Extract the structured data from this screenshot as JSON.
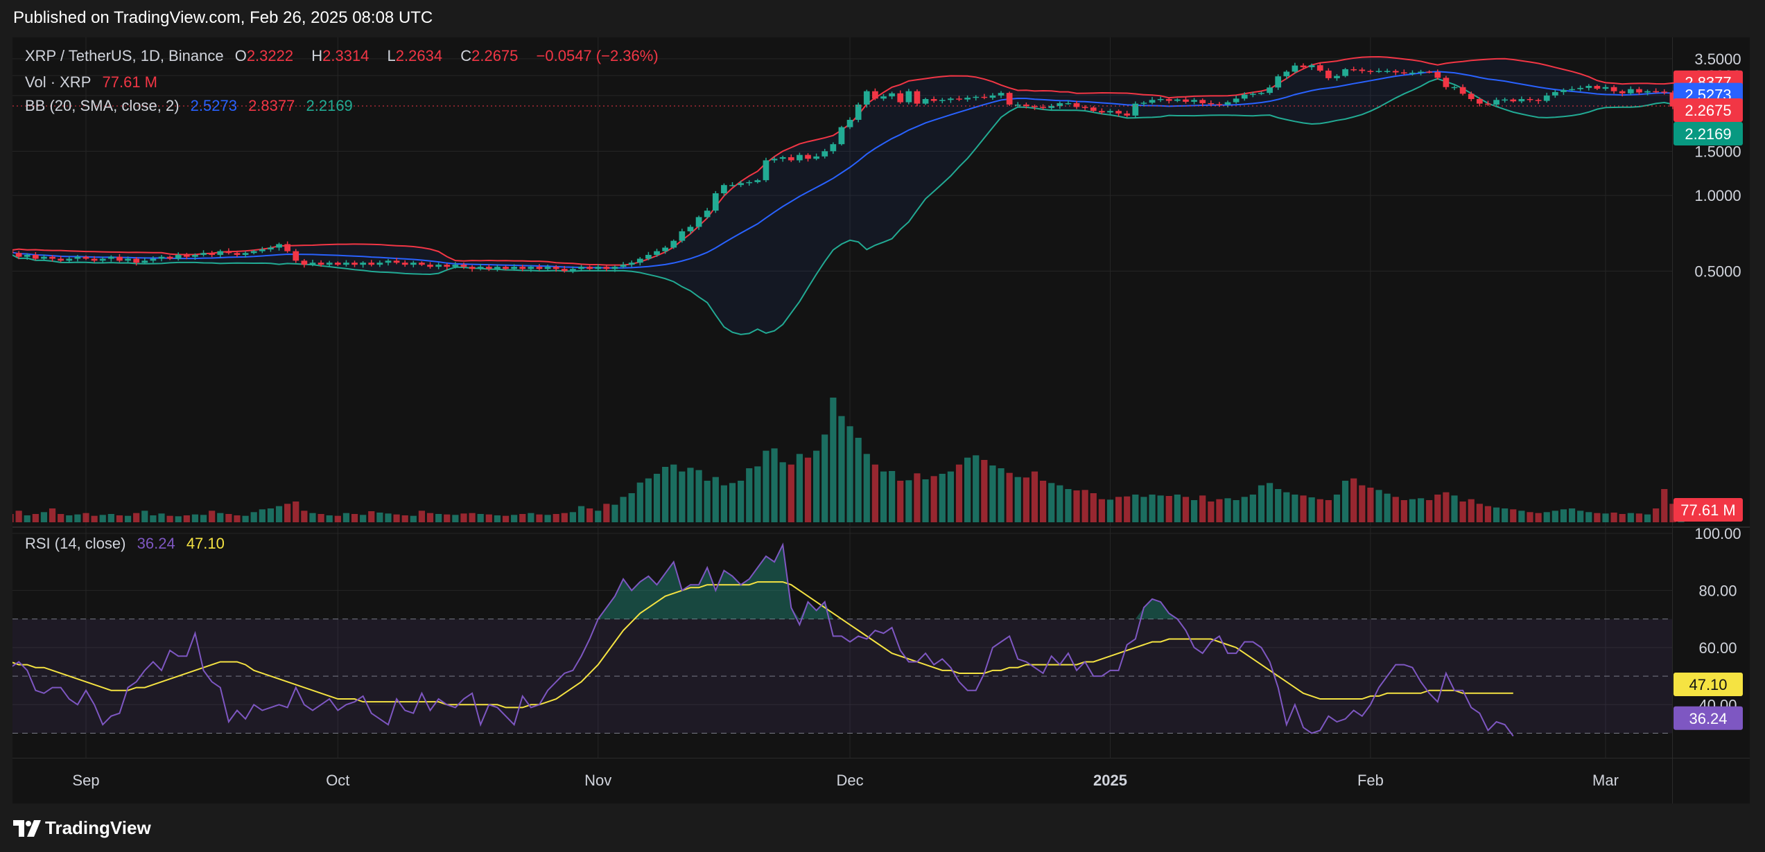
{
  "header": {
    "published": "Published on TradingView.com, Feb 26, 2025 08:08 UTC"
  },
  "footer": {
    "brand": "TradingView"
  },
  "legend": {
    "symbol": "XRP / TetherUS, 1D, Binance",
    "o_label": "O",
    "o": "2.3222",
    "h_label": "H",
    "h": "2.3314",
    "l_label": "L",
    "l": "2.2634",
    "c_label": "C",
    "c": "2.2675",
    "change": "−0.0547 (−2.36%)",
    "vol_label": "Vol · XRP",
    "vol": "77.61 M",
    "bb_label": "BB (20, SMA, close, 2)",
    "bb_basis": "2.5273",
    "bb_upper": "2.8377",
    "bb_lower": "2.2169",
    "rsi_label": "RSI (14, close)",
    "rsi": "36.24",
    "rsi_ma": "47.10"
  },
  "badges": {
    "upper": "2.8377",
    "basis": "2.5273",
    "close": "2.2675",
    "lower": "2.2169",
    "vol": "77.61 M",
    "rsi_ma": "47.10",
    "rsi": "36.24"
  },
  "colors": {
    "up": "#22ab94",
    "down": "#f23645",
    "basis": "#2962ff",
    "upper": "#f23645",
    "lower": "#22ab94",
    "rsi": "#7e57c2",
    "rsi_ma": "#f5e342",
    "bg": "#131313",
    "grid": "#262626"
  },
  "chart_data": {
    "type": "candlestick",
    "price_axis": {
      "ticks": [
        3.5,
        3.0,
        2.5,
        1.5,
        1.0,
        0.5
      ],
      "labels": [
        "3.5000",
        "3.0000",
        "2.5000",
        "1.5000",
        "1.0000",
        "0.5000"
      ],
      "ylim": [
        0.05,
        3.75
      ]
    },
    "rsi_axis": {
      "ticks": [
        100,
        80,
        60,
        40
      ],
      "labels": [
        "100.00",
        "80.00",
        "60.00",
        "40.00"
      ],
      "ylim": [
        26,
        100
      ],
      "bands": [
        70,
        50,
        30
      ]
    },
    "x_labels": [
      {
        "label": "Sep",
        "day": 0
      },
      {
        "label": "Oct",
        "day": 30
      },
      {
        "label": "Nov",
        "day": 61
      },
      {
        "label": "Dec",
        "day": 91
      },
      {
        "label": "2025",
        "day": 122,
        "bold": true
      },
      {
        "label": "Feb",
        "day": 153
      },
      {
        "label": "Mar",
        "day": 181
      }
    ],
    "first_day": -10,
    "series_values": {
      "close": [
        0.6,
        0.59,
        0.57,
        0.58,
        0.56,
        0.57,
        0.56,
        0.55,
        0.56,
        0.57,
        0.56,
        0.55,
        0.56,
        0.57,
        0.55,
        0.56,
        0.54,
        0.55,
        0.56,
        0.57,
        0.56,
        0.58,
        0.57,
        0.58,
        0.59,
        0.58,
        0.6,
        0.59,
        0.58,
        0.59,
        0.6,
        0.61,
        0.62,
        0.64,
        0.6,
        0.55,
        0.53,
        0.54,
        0.53,
        0.54,
        0.53,
        0.54,
        0.53,
        0.54,
        0.53,
        0.54,
        0.55,
        0.54,
        0.53,
        0.54,
        0.53,
        0.52,
        0.53,
        0.52,
        0.53,
        0.52,
        0.51,
        0.52,
        0.51,
        0.52,
        0.51,
        0.52,
        0.51,
        0.52,
        0.51,
        0.52,
        0.51,
        0.5,
        0.51,
        0.52,
        0.51,
        0.52,
        0.51,
        0.52,
        0.53,
        0.54,
        0.56,
        0.58,
        0.6,
        0.62,
        0.66,
        0.72,
        0.75,
        0.82,
        0.87,
        1.02,
        1.1,
        1.1,
        1.12,
        1.13,
        1.15,
        1.38,
        1.4,
        1.42,
        1.38,
        1.45,
        1.4,
        1.43,
        1.5,
        1.6,
        1.87,
        2.0,
        2.3,
        2.6,
        2.43,
        2.48,
        2.55,
        2.35,
        2.6,
        2.32,
        2.42,
        2.38,
        2.4,
        2.43,
        2.41,
        2.45,
        2.47,
        2.45,
        2.5,
        2.56,
        2.3,
        2.3,
        2.27,
        2.25,
        2.23,
        2.27,
        2.33,
        2.33,
        2.25,
        2.24,
        2.17,
        2.14,
        2.17,
        2.12,
        2.08,
        2.32,
        2.34,
        2.4,
        2.42,
        2.38,
        2.41,
        2.36,
        2.4,
        2.33,
        2.31,
        2.3,
        2.35,
        2.43,
        2.52,
        2.54,
        2.56,
        2.69,
        2.98,
        3.11,
        3.29,
        3.24,
        3.3,
        3.14,
        2.93,
        2.99,
        3.18,
        3.17,
        3.13,
        3.12,
        3.13,
        3.13,
        3.09,
        3.06,
        3.08,
        3.11,
        3.1,
        2.94,
        2.7,
        2.7,
        2.54,
        2.42,
        2.32,
        2.3,
        2.4,
        2.41,
        2.37,
        2.42,
        2.4,
        2.38,
        2.5,
        2.58,
        2.63,
        2.65,
        2.68,
        2.73,
        2.66,
        2.7,
        2.6,
        2.55,
        2.65,
        2.57,
        2.6,
        2.59,
        2.57,
        2.26,
        2.32,
        2.27
      ],
      "volume_m": [
        20,
        18,
        25,
        15,
        18,
        22,
        30,
        18,
        15,
        17,
        20,
        14,
        16,
        18,
        15,
        14,
        20,
        25,
        15,
        19,
        14,
        13,
        15,
        17,
        16,
        25,
        20,
        18,
        15,
        14,
        22,
        28,
        30,
        35,
        40,
        45,
        25,
        20,
        18,
        15,
        14,
        20,
        18,
        16,
        24,
        21,
        19,
        17,
        15,
        14,
        25,
        20,
        18,
        17,
        16,
        19,
        20,
        18,
        17,
        15,
        14,
        16,
        18,
        20,
        17,
        16,
        18,
        20,
        22,
        35,
        30,
        25,
        40,
        38,
        55,
        63,
        86,
        95,
        105,
        120,
        125,
        110,
        118,
        113,
        90,
        98,
        80,
        85,
        90,
        117,
        121,
        155,
        160,
        130,
        125,
        148,
        140,
        155,
        190,
        270,
        230,
        208,
        183,
        148,
        125,
        110,
        111,
        90,
        91,
        106,
        93,
        100,
        105,
        110,
        125,
        140,
        145,
        135,
        123,
        117,
        107,
        98,
        97,
        110,
        90,
        85,
        80,
        72,
        69,
        70,
        63,
        50,
        49,
        55,
        56,
        60,
        55,
        60,
        58,
        57,
        60,
        55,
        48,
        58,
        45,
        50,
        52,
        48,
        55,
        60,
        80,
        85,
        72,
        65,
        60,
        58,
        54,
        50,
        48,
        60,
        90,
        95,
        80,
        75,
        70,
        62,
        55,
        48,
        50,
        52,
        48,
        60,
        65,
        58,
        45,
        50,
        40,
        35,
        32,
        30,
        28,
        25,
        22,
        20,
        22,
        25,
        28,
        30,
        25,
        22,
        20,
        19,
        21,
        18,
        20,
        19,
        17,
        30,
        72,
        40,
        8
      ],
      "rsi": [
        53,
        53,
        55,
        52,
        45,
        44,
        46,
        46,
        42,
        40,
        45,
        40,
        33,
        36,
        37,
        46,
        48,
        52,
        55,
        52,
        59,
        57,
        57,
        65,
        52,
        48,
        46,
        34,
        38,
        35,
        40,
        38,
        39,
        40,
        39,
        46,
        40,
        38,
        40,
        42,
        38,
        40,
        41,
        43,
        37,
        35,
        33,
        42,
        38,
        37,
        44,
        38,
        42,
        40,
        39,
        42,
        44,
        33,
        40,
        39,
        36,
        33,
        43,
        39,
        40,
        45,
        48,
        51,
        52,
        57,
        63,
        70,
        74,
        78,
        84,
        80,
        83,
        85,
        82,
        86,
        90,
        80,
        82,
        82,
        88,
        80,
        87,
        85,
        82,
        84,
        88,
        92,
        90,
        96,
        74,
        68,
        76,
        73,
        76,
        64,
        64,
        62,
        64,
        63,
        66,
        65,
        67,
        59,
        55,
        55,
        58,
        54,
        56,
        53,
        48,
        45,
        45,
        51,
        60,
        62,
        64,
        56,
        55,
        53,
        51,
        57,
        54,
        58,
        52,
        55,
        50,
        50,
        52,
        52,
        61,
        63,
        74,
        77,
        76,
        72,
        70,
        66,
        60,
        58,
        62,
        64,
        58,
        58,
        62,
        62,
        60,
        55,
        46,
        33,
        40,
        32,
        30,
        31,
        36,
        34,
        35,
        38,
        36,
        40,
        46,
        50,
        54,
        54,
        53,
        48,
        44,
        41,
        51,
        45,
        45,
        39,
        37,
        31,
        34,
        33,
        29
      ],
      "rsi_ma": [
        55,
        55,
        54,
        54,
        53,
        53,
        52,
        51,
        50,
        49,
        48,
        47,
        46,
        45,
        45,
        45,
        46,
        46,
        47,
        48,
        49,
        50,
        51,
        52,
        53,
        54,
        55,
        55,
        55,
        54,
        52,
        51,
        50,
        49,
        48,
        47,
        46,
        45,
        44,
        43,
        42,
        42,
        42,
        41,
        41,
        41,
        41,
        41,
        41,
        41,
        41,
        41,
        41,
        40,
        40,
        40,
        40,
        40,
        40,
        40,
        39,
        39,
        39,
        40,
        40,
        41,
        42,
        44,
        46,
        48,
        51,
        54,
        58,
        62,
        66,
        69,
        72,
        74,
        76,
        78,
        79,
        80,
        81,
        81,
        82,
        82,
        82,
        82,
        82,
        82,
        83,
        83,
        83,
        83,
        82,
        80,
        78,
        76,
        74,
        72,
        70,
        68,
        66,
        64,
        62,
        60,
        58,
        57,
        56,
        55,
        54,
        53,
        52,
        52,
        51,
        51,
        51,
        51,
        52,
        52,
        53,
        53,
        54,
        54,
        54,
        54,
        54,
        54,
        54,
        55,
        55,
        56,
        57,
        58,
        59,
        60,
        61,
        62,
        62,
        63,
        63,
        63,
        63,
        63,
        63,
        62,
        61,
        60,
        58,
        56,
        54,
        52,
        50,
        48,
        46,
        44,
        43,
        42,
        42,
        42,
        42,
        42,
        42,
        43,
        43,
        44,
        44,
        44,
        44,
        44,
        45,
        45,
        45,
        45,
        44,
        44,
        44,
        44,
        44,
        44,
        44
      ]
    }
  }
}
